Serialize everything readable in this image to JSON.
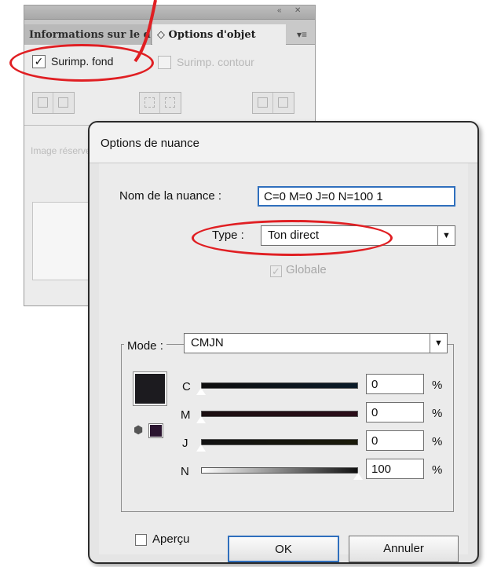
{
  "panel": {
    "titlebar_buttons": [
      "«",
      "✕"
    ],
    "tab_inactive": "Informations sur le document",
    "tab_active": "◇ Options d'objet",
    "menu_icon": "▾≡",
    "overprint_fill_label": "Surimp. fond",
    "overprint_stroke_label": "Surimp. contour",
    "image_label": "Image réservée"
  },
  "dialog": {
    "title": "Options de nuance",
    "swatch_name_label": "Nom de la nuance :",
    "swatch_name_value": "C=0 M=0 J=0 N=100 1",
    "type_label": "Type :",
    "type_value": "Ton direct",
    "globale_label": "Globale",
    "mode_label": "Mode :",
    "mode_value": "CMJN",
    "channels": [
      {
        "letter": "C",
        "value": "0",
        "level": 0
      },
      {
        "letter": "M",
        "value": "0",
        "level": 0
      },
      {
        "letter": "J",
        "value": "0",
        "level": 0
      },
      {
        "letter": "N",
        "value": "100",
        "level": 100
      }
    ],
    "percent_sign": "%",
    "preview_label": "Aperçu",
    "ok_label": "OK",
    "cancel_label": "Annuler"
  },
  "colors": {
    "highlight": "#e01f23",
    "focus": "#2f6fbd",
    "swatch": "#1c1b1f"
  }
}
